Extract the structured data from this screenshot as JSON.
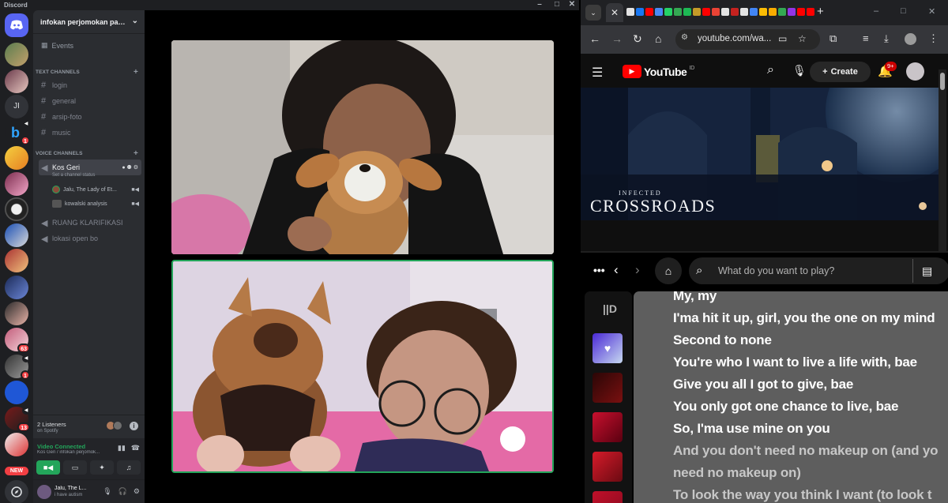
{
  "discord": {
    "app_name": "Discord",
    "guild_name": "infokan perjomokan pak...",
    "events_label": "Events",
    "text_category": "TEXT CHANNELS",
    "text_channels": [
      "login",
      "general",
      "arsip-foto",
      "music"
    ],
    "voice_category": "VOICE CHANNELS",
    "active_voice_channel": "Kos Geri",
    "channel_status": "Set a channel status",
    "voice_users": [
      "Jalu, The Lady of Et...",
      "kowalski analysis"
    ],
    "other_voice_channels": [
      "RUANG KLARIFIKASI",
      "lokasi open bo"
    ],
    "listeners_count": "2 Listeners",
    "listeners_source": "on Spotify",
    "video_status": "Video Connected",
    "voice_location": "Kos Geri / infokan perjomok...",
    "user_name": "Jalu, The L...",
    "user_status": "i have autism",
    "new_badge": "NEW",
    "server_initials": "JI",
    "badges": {
      "b1": "1",
      "b2": "1",
      "b3": "63",
      "b4": "1",
      "b5": "13"
    }
  },
  "browser": {
    "url": "youtube.com/wa...",
    "youtube": {
      "logo_text": "YouTube",
      "country_code": "ID",
      "create_label": "Create",
      "notification_count": "9+",
      "video_subtitle": "INFECTED",
      "video_title": "CROSSROADS"
    },
    "spotify": {
      "search_placeholder": "What do you want to play?",
      "lyrics": [
        "My, my",
        "I'ma hit it up, girl, you the one on my mind",
        "Second to none",
        "You're who I want to live a life with, bae",
        "Give you all I got to give, bae",
        "You only got one chance to live, bae",
        "So, I'ma use mine on you",
        "And you don't need no makeup on (and yo",
        "need no makeup on)",
        "To look the way you think I want (to look t"
      ]
    }
  },
  "colors": {
    "discord_bg": "#1e1f22",
    "discord_sidebar": "#2b2d31",
    "discord_green": "#23a55a",
    "youtube_red": "#ff0000",
    "spotify_lyrics_bg": "#5e5e5e"
  }
}
